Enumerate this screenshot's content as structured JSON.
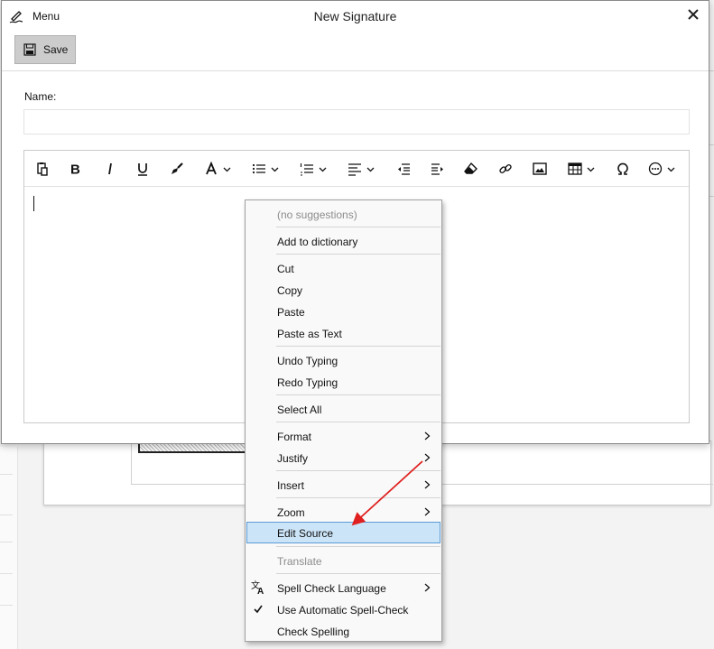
{
  "dialog": {
    "title": "New Signature",
    "menu_label": "Menu",
    "save_label": "Save"
  },
  "form": {
    "name_label": "Name:",
    "name_value": "",
    "name_placeholder": ""
  },
  "editor": {
    "toolbar": [
      {
        "name": "paste-icon"
      },
      {
        "name": "bold-icon"
      },
      {
        "name": "italic-icon"
      },
      {
        "name": "underline-icon"
      },
      {
        "name": "format-painter-icon"
      },
      {
        "name": "font-color-icon",
        "dropdown": true
      },
      {
        "name": "bullet-list-icon",
        "dropdown": true
      },
      {
        "name": "numbered-list-icon",
        "dropdown": true
      },
      {
        "name": "align-icon",
        "dropdown": true
      },
      {
        "name": "outdent-icon"
      },
      {
        "name": "indent-icon"
      },
      {
        "name": "eraser-icon"
      },
      {
        "name": "link-icon"
      },
      {
        "name": "image-icon"
      },
      {
        "name": "table-icon",
        "dropdown": true
      },
      {
        "name": "omega-icon"
      },
      {
        "name": "more-icon",
        "dropdown": true
      }
    ],
    "font_color_glyph": "A",
    "omega_glyph": "Ω"
  },
  "context_menu": {
    "items": [
      {
        "label": "(no suggestions)",
        "disabled": true
      },
      {
        "label": "Add to dictionary"
      },
      {
        "label": "Cut"
      },
      {
        "label": "Copy"
      },
      {
        "label": "Paste"
      },
      {
        "label": "Paste as Text"
      },
      {
        "label": "Undo Typing"
      },
      {
        "label": "Redo Typing"
      },
      {
        "label": "Select All"
      },
      {
        "label": "Format",
        "submenu": true
      },
      {
        "label": "Justify",
        "submenu": true
      },
      {
        "label": "Insert",
        "submenu": true
      },
      {
        "label": "Zoom",
        "submenu": true
      },
      {
        "label": "Edit Source",
        "highlighted": true
      },
      {
        "label": "Translate",
        "disabled": true
      },
      {
        "label": "Spell Check Language",
        "submenu": true,
        "icon": "translate-icon"
      },
      {
        "label": "Use Automatic Spell-Check",
        "checked": true
      },
      {
        "label": "Check Spelling"
      }
    ]
  },
  "colors": {
    "highlight_bg": "#cce4f7",
    "highlight_border": "#5a9bd6",
    "annotation_arrow": "#e02020",
    "save_button_bg": "#cccccc"
  }
}
